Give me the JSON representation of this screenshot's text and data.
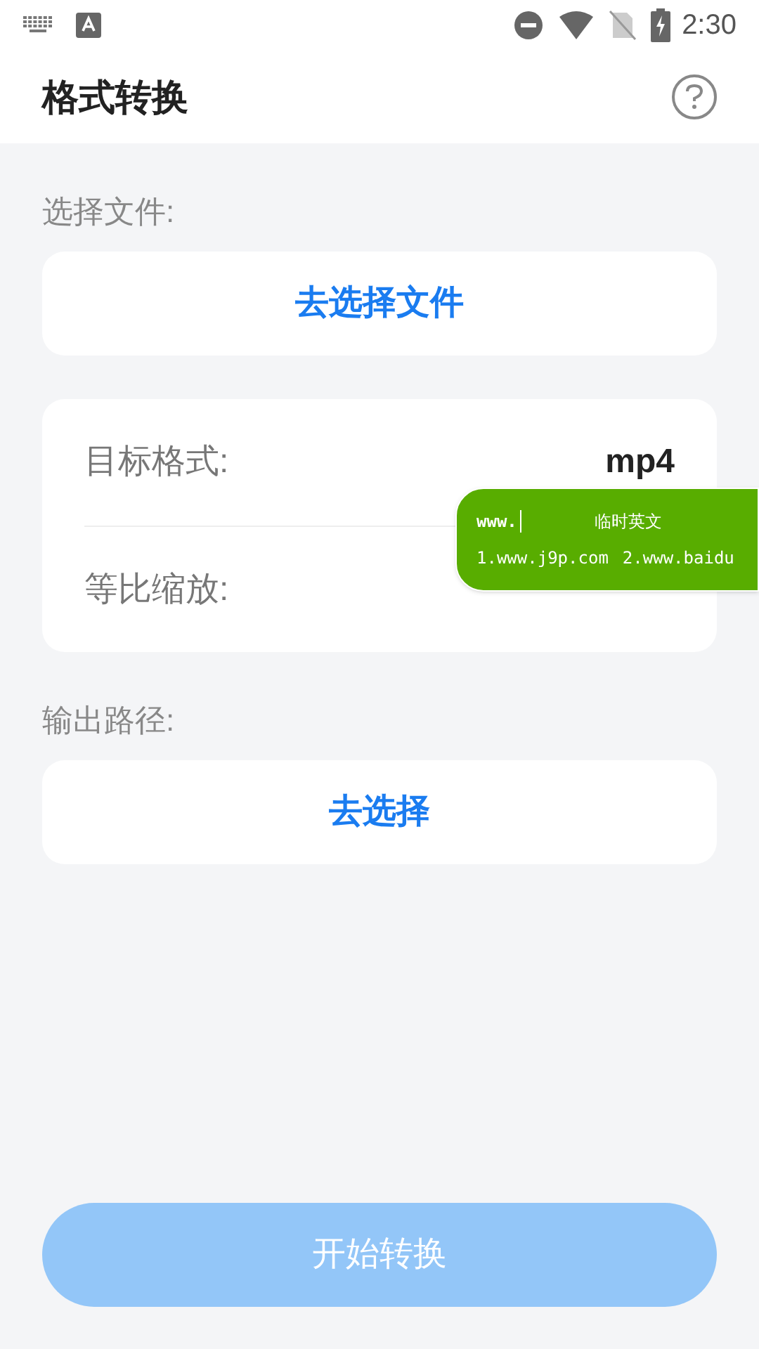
{
  "status_bar": {
    "time": "2:30"
  },
  "header": {
    "title": "格式转换"
  },
  "file_section": {
    "label": "选择文件:",
    "button": "去选择文件"
  },
  "settings": [
    {
      "label": "目标格式:",
      "value": "mp4"
    },
    {
      "label": "等比缩放:"
    }
  ],
  "output_section": {
    "label": "输出路径:",
    "button": "去选择"
  },
  "ime_popup": {
    "input": "www.",
    "mode": "临时英文",
    "candidates": [
      "1.www.j9p.com",
      "2.www.baidu"
    ]
  },
  "start_button": {
    "label": "开始转换",
    "disabled": true
  }
}
